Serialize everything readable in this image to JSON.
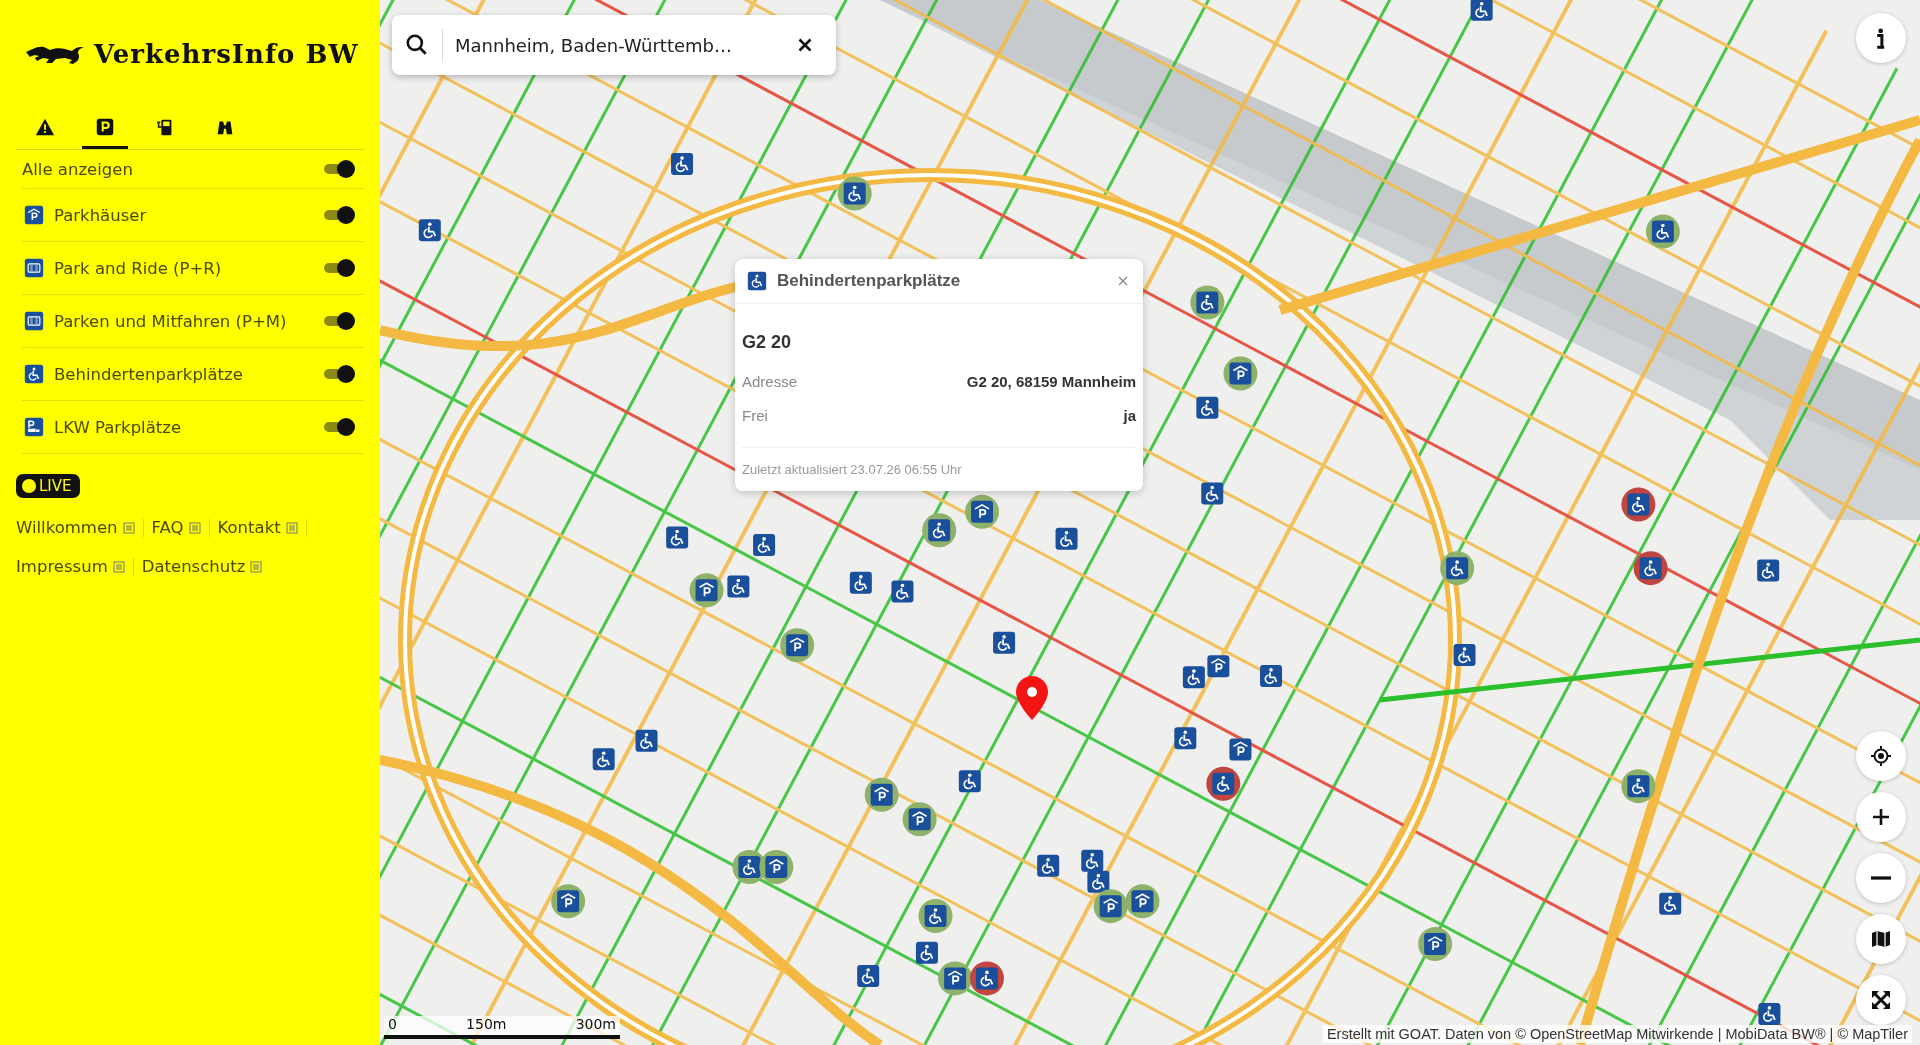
{
  "app": {
    "title": "VerkehrsInfo BW"
  },
  "category_tabs": [
    {
      "kind": "warning",
      "selected": false
    },
    {
      "kind": "parking",
      "selected": true
    },
    {
      "kind": "charging",
      "selected": false
    },
    {
      "kind": "binoculars",
      "selected": false
    }
  ],
  "show_all": {
    "label": "Alle anzeigen",
    "on": true
  },
  "layers": [
    {
      "kind": "garage",
      "label": "Parkhäuser",
      "on": true
    },
    {
      "kind": "park-ride",
      "label": "Park and Ride (P+R)",
      "on": true
    },
    {
      "kind": "park-ride",
      "label": "Parken und Mitfahren (P+M)",
      "on": true
    },
    {
      "kind": "wheelchair",
      "label": "Behindertenparkplätze",
      "on": true
    },
    {
      "kind": "truck",
      "label": "LKW Parkplätze",
      "on": true
    }
  ],
  "live_badge": {
    "label": "LIVE"
  },
  "footer_links": [
    [
      {
        "label": "Willkommen"
      },
      {
        "label": "FAQ"
      },
      {
        "label": "Kontakt"
      }
    ],
    [
      {
        "label": "Impressum"
      },
      {
        "label": "Datenschutz"
      }
    ]
  ],
  "search": {
    "value": "Mannheim, Baden-Württemb…"
  },
  "popup": {
    "category": "Behindertenparkplätze",
    "title": "G2 20",
    "fields": [
      {
        "label": "Adresse",
        "value": "G2 20, 68159 Mannheim"
      },
      {
        "label": "Frei",
        "value": "ja"
      }
    ],
    "updated": "Zuletzt aktualisiert 23.07.26 06:55 Uhr"
  },
  "scale": {
    "ticks": [
      "0",
      "150m",
      "300m"
    ]
  },
  "attribution": "Erstellt mit GOAT. Daten von © OpenStreetMap Mitwirkende | MobiData BW® | © MapTiler",
  "map_controls": [
    {
      "kind": "info"
    },
    {
      "kind": "locate"
    },
    {
      "kind": "zoom-in"
    },
    {
      "kind": "zoom-out"
    },
    {
      "kind": "map-style"
    },
    {
      "kind": "fullscreen"
    }
  ]
}
